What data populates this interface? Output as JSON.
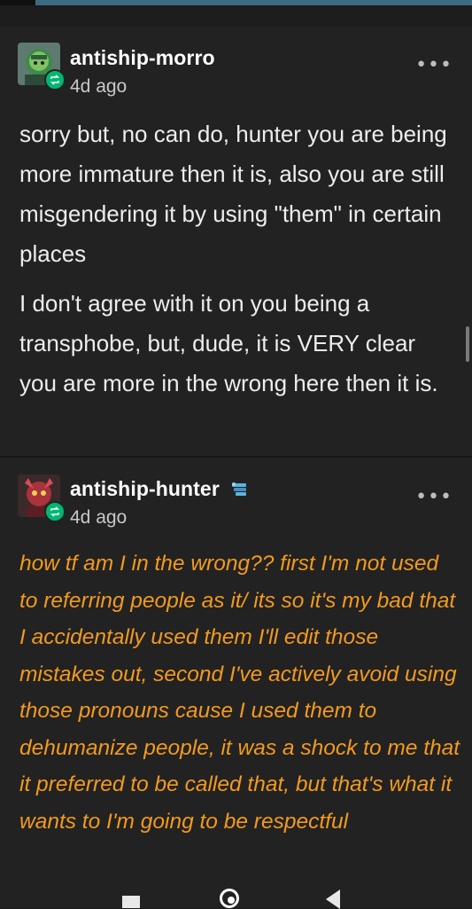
{
  "posts": [
    {
      "username": "antiship-morro",
      "timestamp": "4d ago",
      "more": "•••",
      "paragraphs": [
        "sorry but, no can do, hunter you are being more immature then it is, also you are still misgendering it by using \"them\" in certain places",
        "I don't agree with it on you being a transphobe, but, dude, it is VERY clear you are more in the wrong here then it is."
      ]
    },
    {
      "username": "antiship-hunter",
      "timestamp": "4d ago",
      "more": "•••",
      "text": "how tf am I in the wrong?? first I'm not used to referring people as it/ its so it's my bad that I accidentally used them I'll edit those mistakes out, second I've actively avoid using those pronouns cause I used them to dehumanize people, it was a shock to me that it preferred to be called that, but that's what it wants to I'm going to be respectful"
    }
  ],
  "icons": {
    "reblog": "reblog-icon",
    "badge": "badge-icon",
    "more": "more-icon"
  },
  "colors": {
    "background": "#222222",
    "orange_text": "#f39a1e",
    "reblog_green": "#00b870"
  }
}
